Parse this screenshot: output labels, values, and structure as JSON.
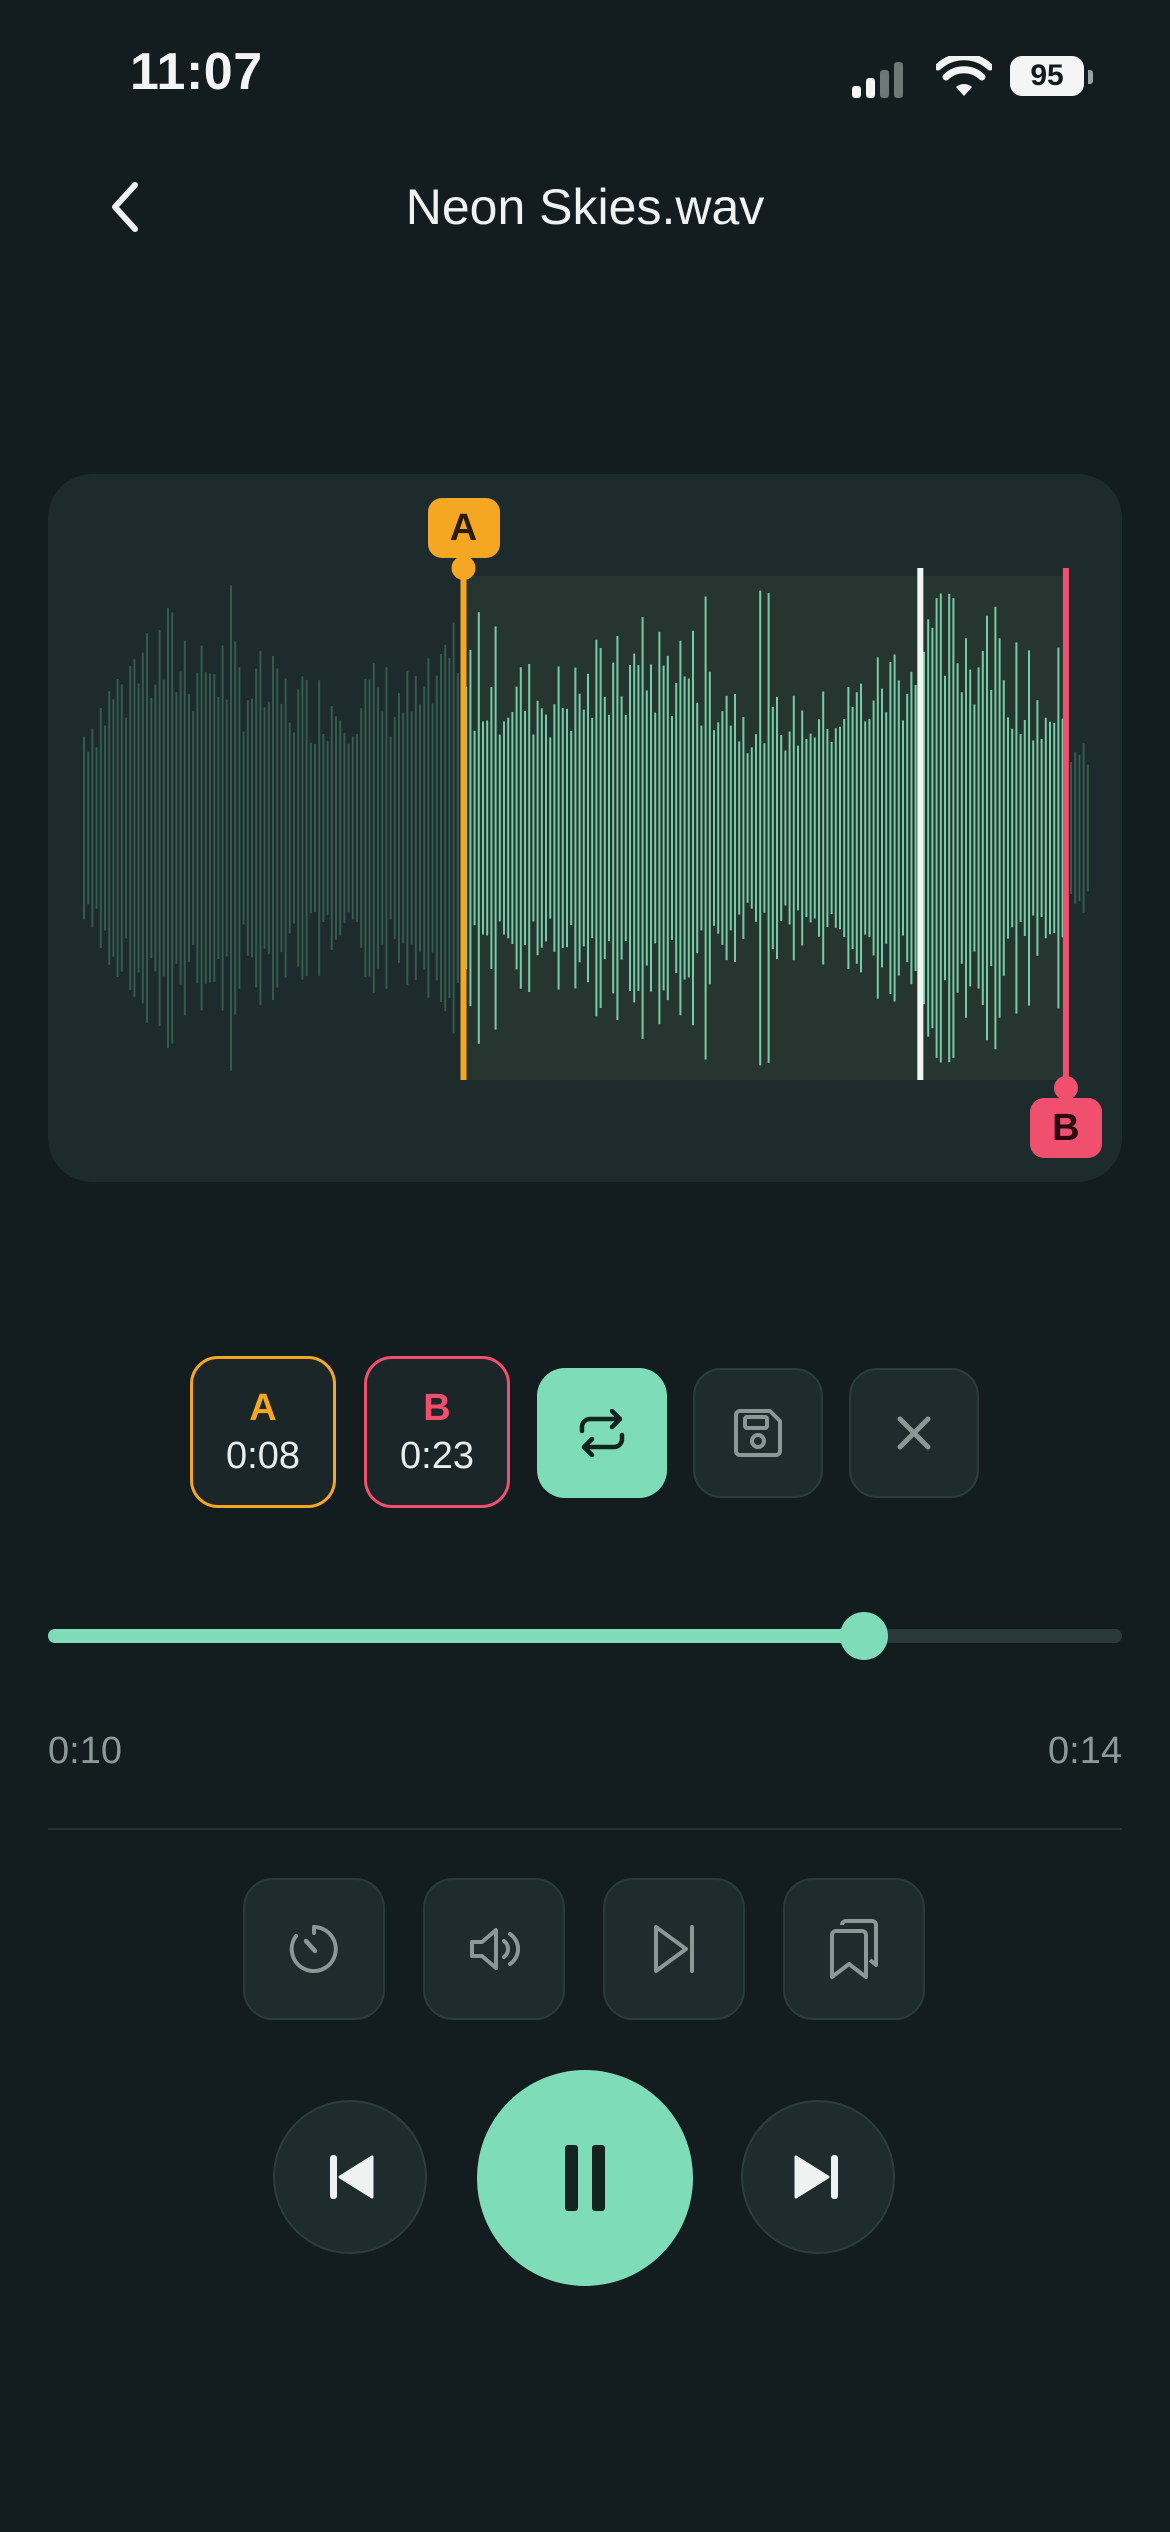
{
  "status_bar": {
    "time": "11:07",
    "battery": "95",
    "icons": [
      "signal-icon",
      "wifi-icon",
      "battery-icon"
    ]
  },
  "header": {
    "back_icon": "chevron-left-icon",
    "title": "Neon Skies.wav"
  },
  "waveform": {
    "marker_a_label": "A",
    "marker_b_label": "B",
    "marker_a_fraction": 0.378,
    "playhead_fraction": 0.833,
    "marker_b_fraction": 0.978
  },
  "loop_controls": {
    "a_label": "A",
    "a_time": "0:08",
    "b_label": "B",
    "b_time": "0:23",
    "loop_icon": "repeat-icon",
    "save_icon": "save-icon",
    "clear_icon": "close-icon"
  },
  "progress": {
    "fraction": 0.76,
    "elapsed": "0:10",
    "remaining": "0:14"
  },
  "tools": [
    "speed-icon",
    "volume-icon",
    "skip-to-end-icon",
    "bookmarks-icon"
  ],
  "transport": {
    "prev_icon": "skip-back-icon",
    "play_icon": "pause-icon",
    "next_icon": "skip-forward-icon"
  },
  "colors": {
    "background": "#131c1e",
    "accent": "#7fdcb8",
    "marker_a": "#f5a623",
    "marker_b": "#f0506e",
    "card": "#1d2b2c"
  }
}
